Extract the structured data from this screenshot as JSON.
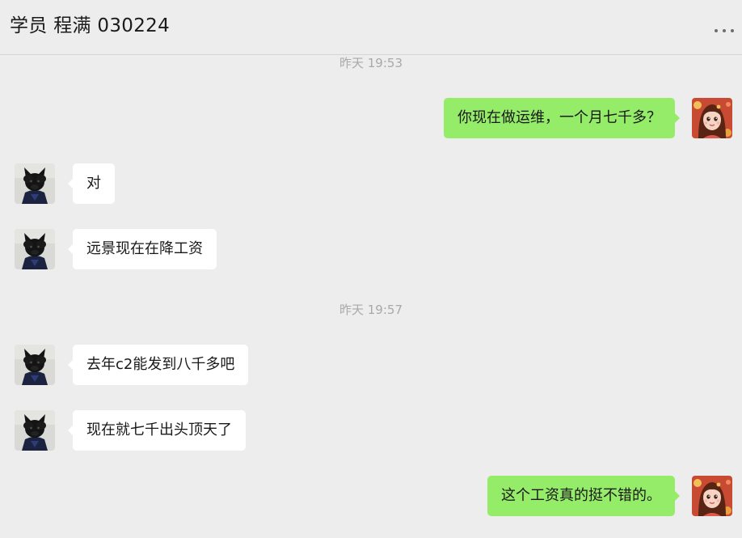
{
  "header": {
    "title": "学员 程满 030224",
    "more_icon": "more-dots-icon"
  },
  "colors": {
    "background": "#ededed",
    "incoming_bubble": "#ffffff",
    "outgoing_bubble": "#95ec69",
    "timestamp_text": "#a9a9a9"
  },
  "timestamps": [
    "昨天 19:53",
    "昨天 19:57"
  ],
  "messages": [
    {
      "direction": "out",
      "text": "你现在做运维，一个月七千多？",
      "avatar": "girl-avatar"
    },
    {
      "direction": "in",
      "text": "对",
      "avatar": "black-cat-avatar"
    },
    {
      "direction": "in",
      "text": "远景现在在降工资",
      "avatar": "black-cat-avatar"
    },
    {
      "direction": "in",
      "text": "去年c2能发到八千多吧",
      "avatar": "black-cat-avatar"
    },
    {
      "direction": "in",
      "text": "现在就七千出头顶天了",
      "avatar": "black-cat-avatar"
    },
    {
      "direction": "out",
      "text": "这个工资真的挺不错的。",
      "avatar": "girl-avatar"
    }
  ]
}
